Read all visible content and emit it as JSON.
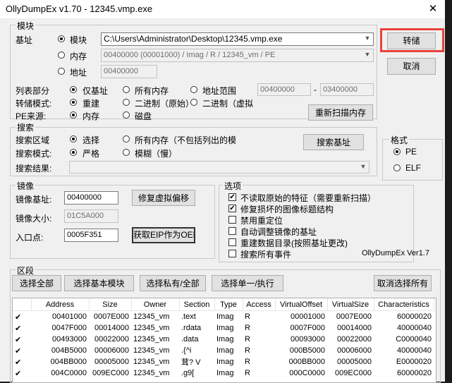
{
  "window": {
    "title": "OllyDumpEx v1.70 - 12345.vmp.exe",
    "close": "✕"
  },
  "module_group": {
    "label": "模块",
    "base_label": "基址",
    "opt_module": "模块",
    "opt_memory": "内存",
    "opt_address": "地址",
    "module_path": "C:\\Users\\Administrator\\Desktop\\12345.vmp.exe",
    "memory_value": "00400000 (00001000) / Imag / R     / 12345_vm / PE",
    "address_value": "00400000"
  },
  "buttons": {
    "dump": "转储",
    "cancel": "取消",
    "rescan": "重新扫描内存",
    "search_base": "搜索基址",
    "fix_virtual": "修复虚拟偏移",
    "get_eip": "获取EIP作为OEP",
    "select_all": "选择全部",
    "select_base_module": "选择基本模块",
    "select_private": "选择私有/全部",
    "select_single": "选择单一/执行",
    "unselect_all": "取消选择所有"
  },
  "list_part": {
    "label": "列表部分",
    "opt1": "仅基址",
    "opt2": "所有内存",
    "opt3": "地址范围",
    "range_from": "00400000",
    "range_sep": "-",
    "range_to": "03400000"
  },
  "dump_mode": {
    "label": "转储模式:",
    "opt1": "重建",
    "opt2": "二进制（原始）",
    "opt3": "二进制（虚拟"
  },
  "pe_source": {
    "label": "PE来源:",
    "opt1": "内存",
    "opt2": "磁盘"
  },
  "search": {
    "label": "搜索",
    "area_label": "搜索区域",
    "area_opt1": "选择",
    "area_opt2": "所有内存（不包括列出的模",
    "mode_label": "搜索模式:",
    "mode_opt1": "严格",
    "mode_opt2": "模糊（慢）",
    "result_label": "搜索结果:",
    "result_value": ""
  },
  "format": {
    "label": "格式",
    "opt1": "PE",
    "opt2": "ELF"
  },
  "image": {
    "label": "镜像",
    "base_label": "镜像基址:",
    "base_value": "00400000",
    "size_label": "镜像大小:",
    "size_value": "01C5A000",
    "entry_label": "入口点:",
    "entry_value": "0005F351"
  },
  "options": {
    "label": "选项",
    "items": [
      {
        "label": "不读取原始的特征（需要重新扫描）",
        "checked": true
      },
      {
        "label": "修复损坏的图像标题结构",
        "checked": true
      },
      {
        "label": "禁用重定位",
        "checked": false
      },
      {
        "label": "自动调整镜像的基址",
        "checked": false
      },
      {
        "label": "重建数据目录(按照基址更改)",
        "checked": false
      },
      {
        "label": "搜索所有事件",
        "checked": false
      }
    ],
    "version": "OllyDumpEx Ver1.7"
  },
  "sections": {
    "label": "区段",
    "columns": [
      "",
      "Address",
      "Size",
      "Owner",
      "Section",
      "Type",
      "Access",
      "VirtualOffset",
      "VirtualSize",
      "Characteristics"
    ],
    "rows": [
      [
        "✔",
        "00401000",
        "0007E000",
        "12345_vm",
        ".text",
        "Imag",
        "R",
        "00001000",
        "0007E000",
        "60000020"
      ],
      [
        "✔",
        "0047F000",
        "00014000",
        "12345_vm",
        ".rdata",
        "Imag",
        "R",
        "0007F000",
        "00014000",
        "40000040"
      ],
      [
        "✔",
        "00493000",
        "00022000",
        "12345_vm",
        ".data",
        "Imag",
        "R",
        "00093000",
        "00022000",
        "C0000040"
      ],
      [
        "✔",
        "004B5000",
        "00006000",
        "12345_vm",
        ".{^i",
        "Imag",
        "R",
        "000B5000",
        "00006000",
        "40000040"
      ],
      [
        "✔",
        "004BB000",
        "00005000",
        "12345_vm",
        "茸?  V",
        "Imag",
        "R",
        "000BB000",
        "00005000",
        "E0000020"
      ],
      [
        "✔",
        "004C0000",
        "009EC000",
        "12345_vm",
        ".g9[",
        "Imag",
        "R",
        "000C0000",
        "009EC000",
        "60000020"
      ]
    ]
  },
  "colors": {
    "highlight": "#e8413b",
    "window_bg": "#f0f0f0"
  }
}
